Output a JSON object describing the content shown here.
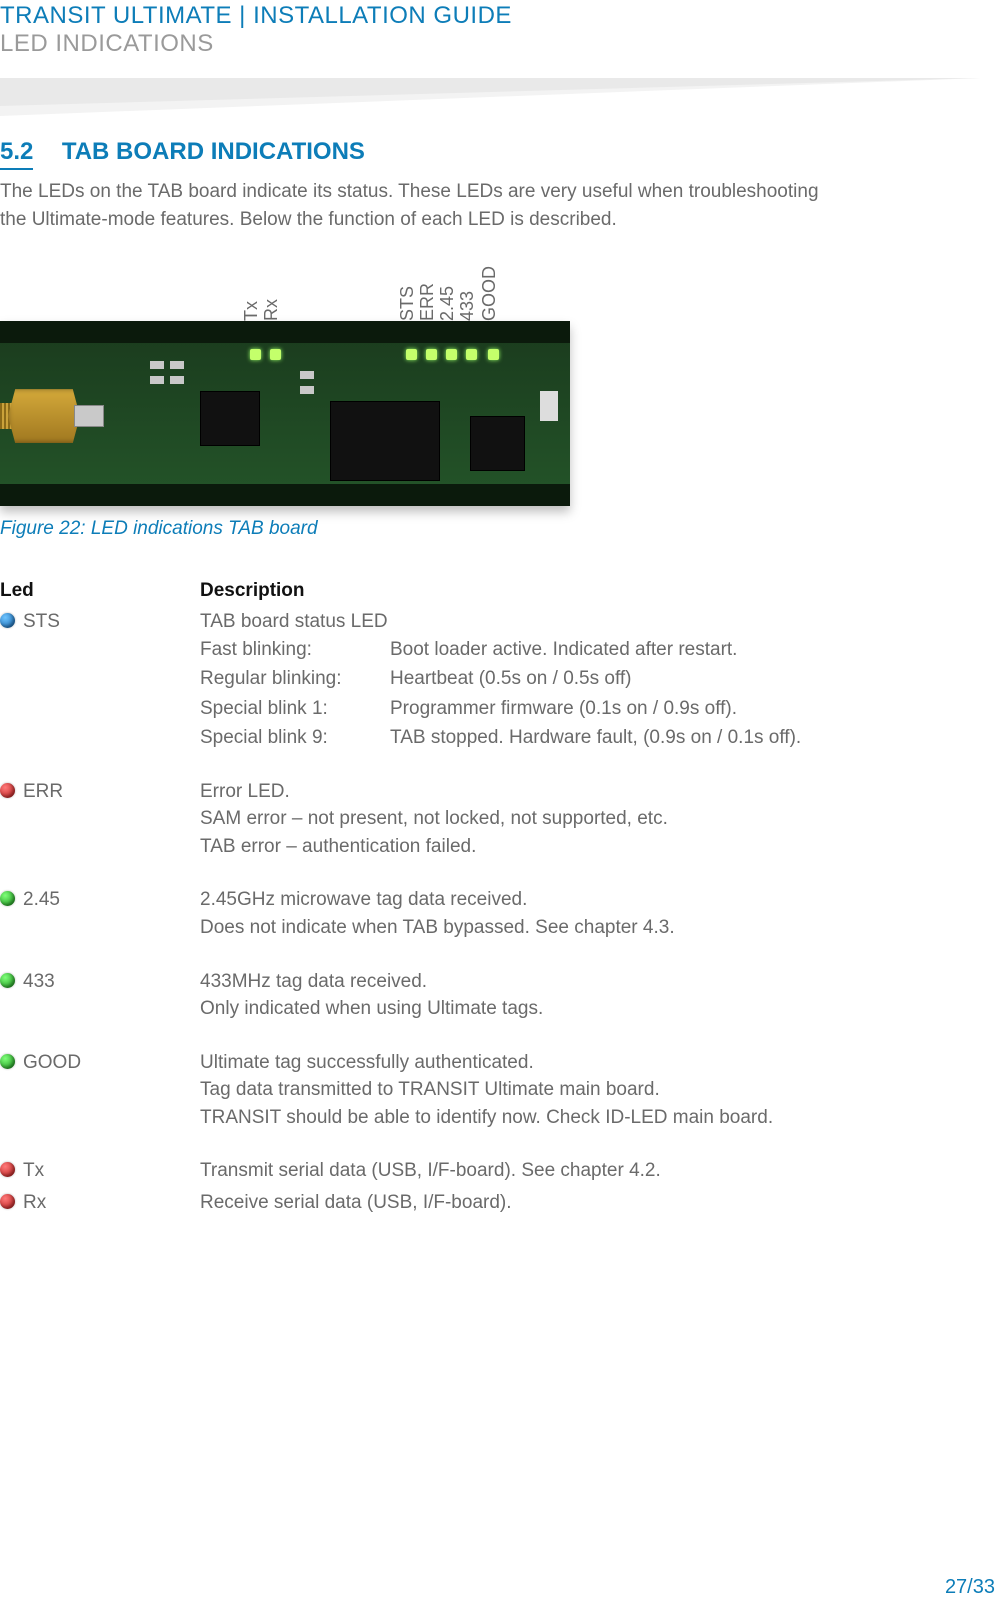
{
  "header": {
    "title": "TRANSIT ULTIMATE | INSTALLATION GUIDE",
    "subtitle": "LED INDICATIONS"
  },
  "section": {
    "number": "5.2",
    "title": "TAB BOARD INDICATIONS",
    "intro": "The LEDs on the TAB board indicate its status. These LEDs are very useful when troubleshooting the Ultimate-mode features. Below the function of each LED is described."
  },
  "figure": {
    "labels": [
      "Tx",
      "Rx",
      "STS",
      "ERR",
      "2.45",
      "433",
      "GOOD"
    ],
    "caption": "Figure 22: LED indications TAB board"
  },
  "table": {
    "head_led": "Led",
    "head_desc": "Description",
    "rows": [
      {
        "dot": "blue",
        "name": "STS",
        "lines": [
          "TAB board status LED"
        ],
        "sub": [
          [
            "Fast blinking:",
            "Boot loader active. Indicated after restart."
          ],
          [
            "Regular blinking:",
            "Heartbeat (0.5s on / 0.5s off)"
          ],
          [
            "Special blink 1:",
            "Programmer firmware (0.1s on / 0.9s off)."
          ],
          [
            "Special blink 9:",
            "TAB stopped. Hardware fault, (0.9s on / 0.1s off)."
          ]
        ]
      },
      {
        "dot": "red",
        "name": "ERR",
        "lines": [
          "Error LED.",
          "SAM error – not present, not locked, not supported, etc.",
          "TAB error – authentication failed."
        ]
      },
      {
        "dot": "green",
        "name": "2.45",
        "lines": [
          "2.45GHz microwave tag data received.",
          "Does not indicate when TAB bypassed. See chapter 4.3."
        ]
      },
      {
        "dot": "green",
        "name": "433",
        "lines": [
          "433MHz tag data received.",
          "Only indicated when using Ultimate tags."
        ]
      },
      {
        "dot": "green",
        "name": "GOOD",
        "lines": [
          "Ultimate tag successfully authenticated.",
          "Tag data transmitted to TRANSIT Ultimate main board.",
          "TRANSIT should be able to identify now. Check ID-LED main board."
        ]
      },
      {
        "dot": "red",
        "name": "Tx",
        "tight": true,
        "lines": [
          "Transmit serial data (USB, I/F-board). See chapter 4.2."
        ]
      },
      {
        "dot": "red",
        "name": "Rx",
        "lines": [
          "Receive serial data (USB, I/F-board)."
        ]
      }
    ]
  },
  "page_number": "27/33"
}
